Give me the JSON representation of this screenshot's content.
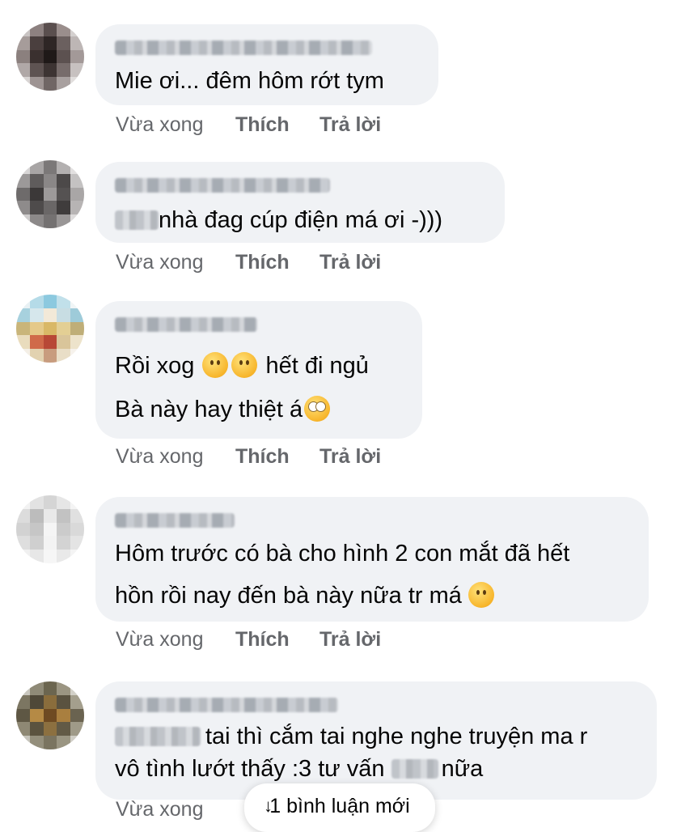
{
  "comments": [
    {
      "lines": [
        "Mie ơi... đêm hôm rớt tym"
      ],
      "time": "Vừa xong",
      "like": "Thích",
      "reply": "Trả lời"
    },
    {
      "lines": [
        "nhà đag cúp điện má ơi -)))"
      ],
      "time": "Vừa xong",
      "like": "Thích",
      "reply": "Trả lời"
    },
    {
      "line1_a": "Rồi xog ",
      "line1_b": " hết đi ngủ",
      "line2": "Bà này hay thiệt á",
      "time": "Vừa xong",
      "like": "Thích",
      "reply": "Trả lời"
    },
    {
      "line1": "Hôm trước có bà cho hình 2 con mắt đã hết",
      "line2": "hồn rồi nay đến bà này nữa tr má",
      "time": "Vừa xong",
      "like": "Thích",
      "reply": "Trả lời"
    },
    {
      "line1": "tai thì cắm tai nghe nghe truyện ma r",
      "line2_a": "vô tình lướt thấy :3 tư vấn ",
      "line2_b": "nữa",
      "time": "Vừa xong"
    }
  ],
  "toast": {
    "label": "1 bình luận mới",
    "icon": "arrow-down-icon"
  },
  "colors": {
    "bubble": "#f0f2f5",
    "meta": "#65676b",
    "text": "#050505"
  }
}
